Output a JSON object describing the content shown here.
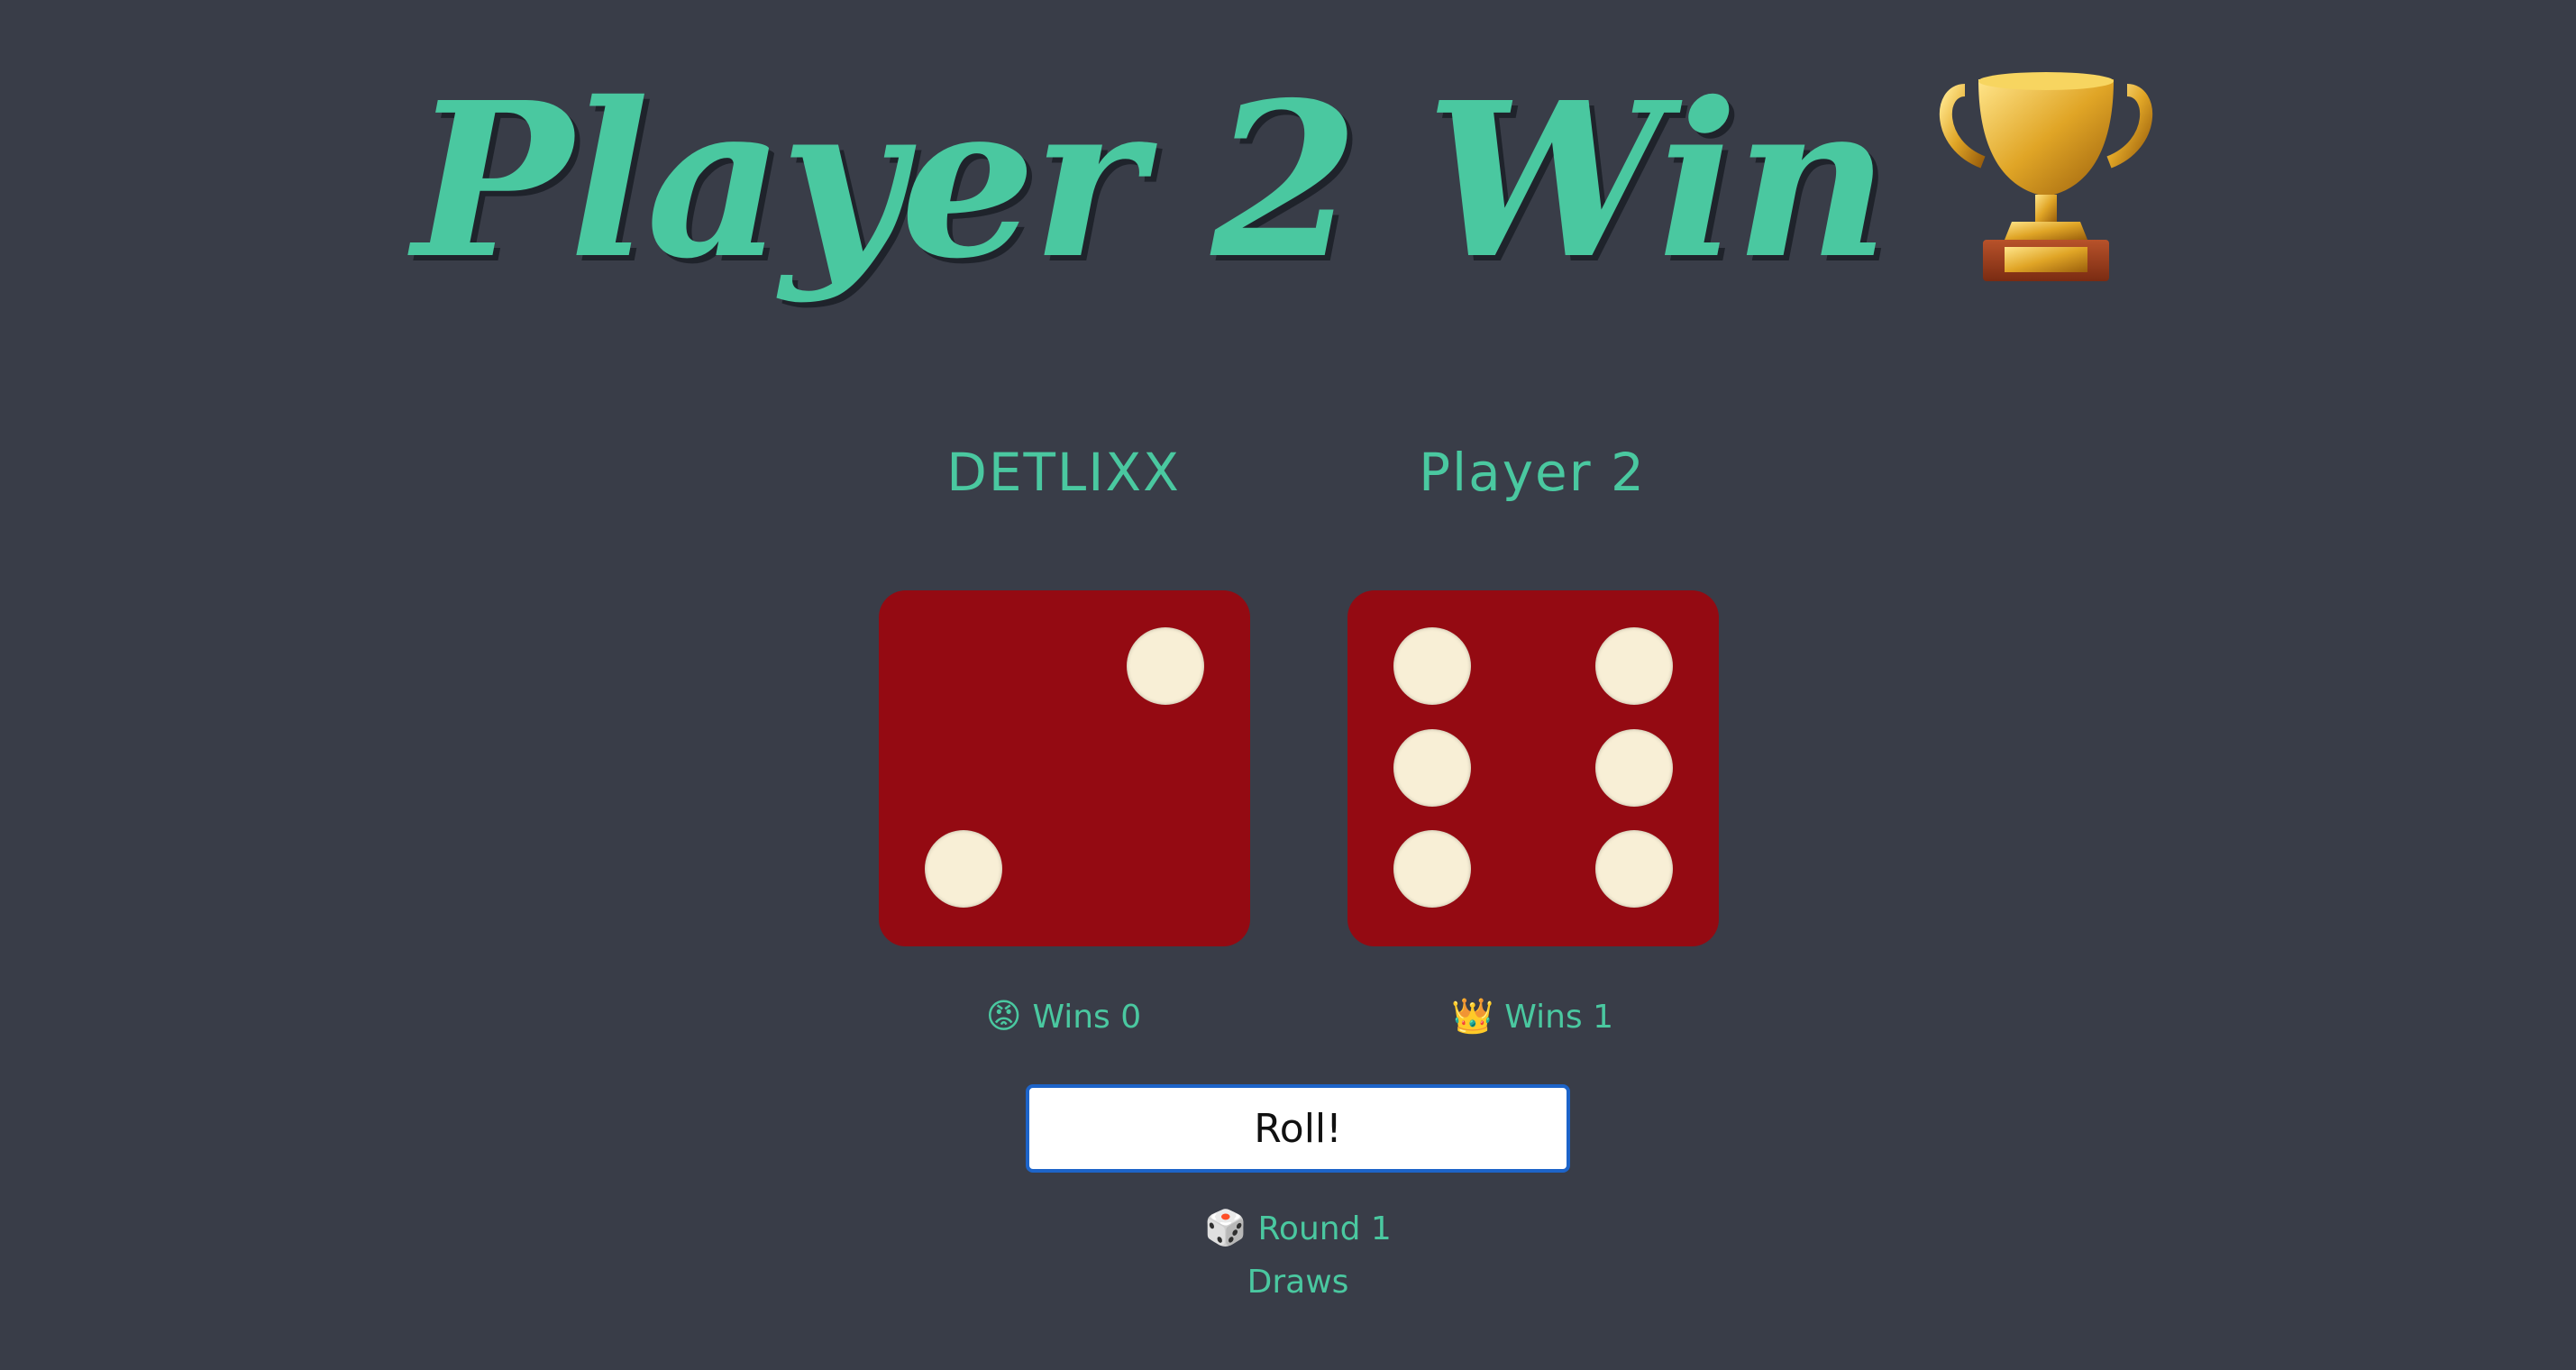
{
  "title": {
    "text": "Player 2 Win",
    "icon": "trophy-icon"
  },
  "players": [
    {
      "name": "DETLIXX",
      "die_value": 2,
      "wins_label": "Wins",
      "wins": "0",
      "status_icon": "angry-face-icon",
      "status_emoji": "😡"
    },
    {
      "name": "Player 2",
      "die_value": 6,
      "wins_label": "Wins",
      "wins": "1",
      "status_icon": "crown-icon",
      "status_emoji": "👑"
    }
  ],
  "roll_button": {
    "label": "Roll!"
  },
  "round": {
    "icon": "die-icon",
    "emoji": "🎲",
    "label": "Round",
    "value": "1",
    "text": "Round 1"
  },
  "draws": {
    "label": "Draws"
  },
  "colors": {
    "background": "#393d48",
    "accent": "#4ac8a0",
    "die": "#940a12",
    "pip": "#f8efd6",
    "button_border": "#1d64c9"
  }
}
